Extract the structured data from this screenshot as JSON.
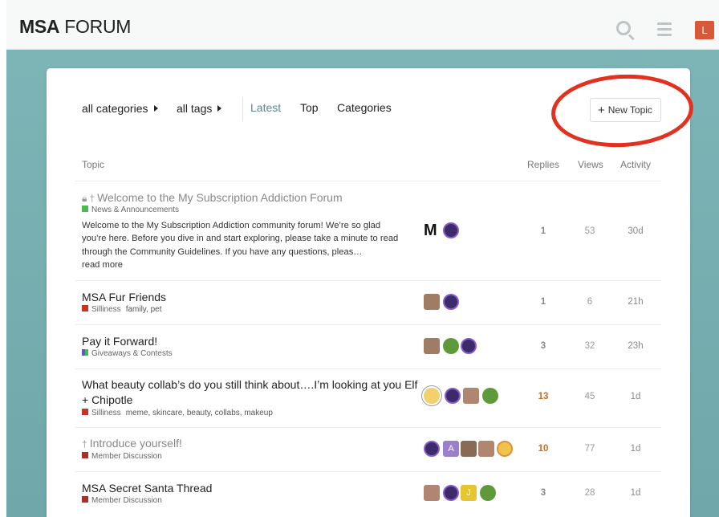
{
  "header": {
    "logo_bold": "MSA",
    "logo_light": " FORUM",
    "user_initial": "L"
  },
  "nav": {
    "categories_dropdown": "all categories",
    "tags_dropdown": "all tags",
    "tabs": [
      "Latest",
      "Top",
      "Categories"
    ],
    "new_topic": "New Topic"
  },
  "table_headers": {
    "topic": "Topic",
    "replies": "Replies",
    "views": "Views",
    "activity": "Activity"
  },
  "colors": {
    "accent": "#5a8a96",
    "hot_replies": "#c96e27",
    "annotation_circle": "#e2321f"
  },
  "topics": [
    {
      "title": "Welcome to the My Subscription Addiction Forum",
      "icons": [
        "lock-icon",
        "pin-icon"
      ],
      "category": "News & Announcements",
      "category_color": "#4db84e",
      "tags": "",
      "excerpt": "Welcome to the My Subscription Addiction community forum! We’re so glad you’re here. Before you dive in and start exploring, please take a minute to read through the Community Guidelines. If you have any questions, pleas…",
      "read_more": "read more",
      "replies": "1",
      "views": "53",
      "activity": "30d"
    },
    {
      "title": "MSA Fur Friends",
      "category": "Silliness",
      "category_color": "#c6332a",
      "tags": "family,  pet",
      "replies": "1",
      "views": "6",
      "activity": "21h"
    },
    {
      "title": "Pay it Forward!",
      "category": "Giveaways & Contests",
      "category_color": "#5a58c2",
      "tags": "",
      "replies": "3",
      "views": "32",
      "activity": "23h"
    },
    {
      "title": "What beauty collab’s do you still think about….I’m looking at you Elf + Chipotle",
      "category": "Silliness",
      "category_color": "#c6332a",
      "tags": "meme,  skincare,  beauty,  collabs,  makeup",
      "replies": "13",
      "views": "45",
      "activity": "1d"
    },
    {
      "title": "Introduce yourself!",
      "icons": [
        "pin-icon"
      ],
      "category": "Member Discussion",
      "category_color": "#a8302a",
      "tags": "",
      "replies": "10",
      "views": "77",
      "activity": "1d"
    },
    {
      "title": "MSA Secret Santa Thread",
      "category": "Member Discussion",
      "category_color": "#a8302a",
      "tags": "",
      "replies": "3",
      "views": "28",
      "activity": "1d"
    }
  ],
  "poster_letters": {
    "a": "A",
    "j": "J",
    "m": "M"
  }
}
